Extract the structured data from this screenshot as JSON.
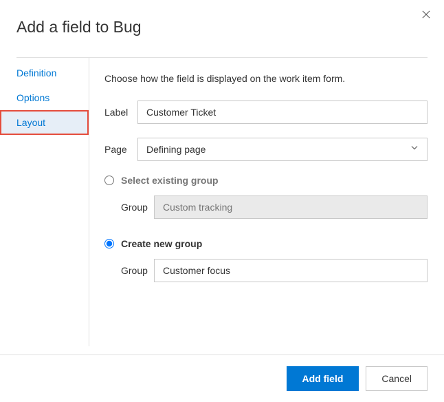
{
  "dialog": {
    "title": "Add a field to Bug"
  },
  "tabs": {
    "items": [
      {
        "label": "Definition",
        "active": false
      },
      {
        "label": "Options",
        "active": false
      },
      {
        "label": "Layout",
        "active": true
      }
    ]
  },
  "panel": {
    "description": "Choose how the field is displayed on the work item form.",
    "labelField": {
      "label": "Label",
      "value": "Customer Ticket"
    },
    "pageField": {
      "label": "Page",
      "value": "Defining page"
    },
    "existingGroup": {
      "radioLabel": "Select existing group",
      "checked": false,
      "groupLabel": "Group",
      "groupValue": "Custom tracking"
    },
    "newGroup": {
      "radioLabel": "Create new group",
      "checked": true,
      "groupLabel": "Group",
      "groupValue": "Customer focus"
    }
  },
  "footer": {
    "primary": "Add field",
    "cancel": "Cancel"
  }
}
